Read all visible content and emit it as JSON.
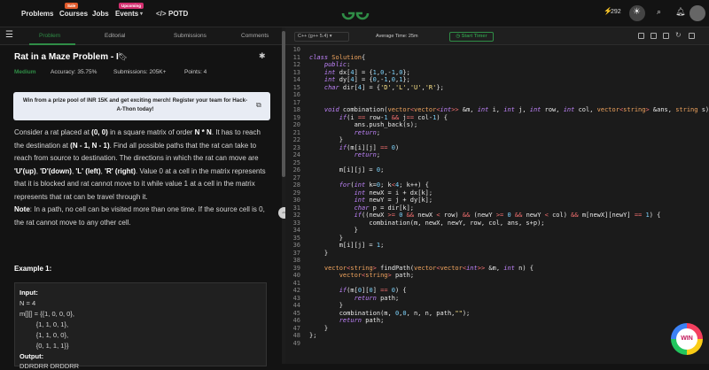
{
  "nav": {
    "problems": "Problems",
    "courses": "Courses",
    "courses_badge": "Sale",
    "jobs": "Jobs",
    "events": "Events",
    "events_badge": "Upcoming",
    "potd": "POTD",
    "streak": "292"
  },
  "colors": {
    "accent": "#2f8d46",
    "badge_sale": "#e05a2b",
    "badge_upcoming": "#d32f6f"
  },
  "tabs": [
    "Problem",
    "Editorial",
    "Submissions",
    "Comments"
  ],
  "problem": {
    "title": "Rat in a Maze Problem - I",
    "difficulty": "Medium",
    "accuracy": "Accuracy: 35.75%",
    "submissions": "Submissions: 205K+",
    "points": "Points: 4",
    "banner": "Win from a prize pool of INR 15K and get exciting merch! Register your team for Hack-A-Thon today!",
    "desc1": "Consider a rat placed at ",
    "desc1b": "(0, 0)",
    "desc1c": " in a square matrix of order ",
    "desc1d": "N * N",
    "desc1e": ". It has to reach the destination at ",
    "desc1f": "(N - 1, N - 1)",
    "desc1g": ". Find all possible paths that the rat can take to reach from source to destination. The directions in which the rat can move are ",
    "desc1h": "'U'(up)",
    "desc1i": ", ",
    "desc1j": "'D'(down)",
    "desc1k": ", ",
    "desc1l": "'L' (left)",
    "desc1m": ", ",
    "desc1n": "'R' (right)",
    "desc1o": ". Value 0 at a cell in the matrix represents that it is blocked and rat cannot move to it while value 1 at a cell in the matrix represents that rat can be travel through it.",
    "note_label": "Note",
    "note_text": ": In a path, no cell can be visited more than one time. If the source cell is 0, the rat cannot move to any other cell.",
    "example_title": "Example 1:",
    "example_lines": [
      "Input:",
      "N = 4",
      "m[][] = {{1, 0, 0, 0},",
      "         {1, 1, 0, 1},",
      "         {1, 1, 0, 0},",
      "         {0, 1, 1, 1}}",
      "Output:",
      "DDRDRR DRDDRR"
    ]
  },
  "editor": {
    "language": "C++ (g++ 5.4)",
    "avg_time": "Average Time: 25m",
    "timer": "Start Timer"
  },
  "win_badge": "WIN"
}
